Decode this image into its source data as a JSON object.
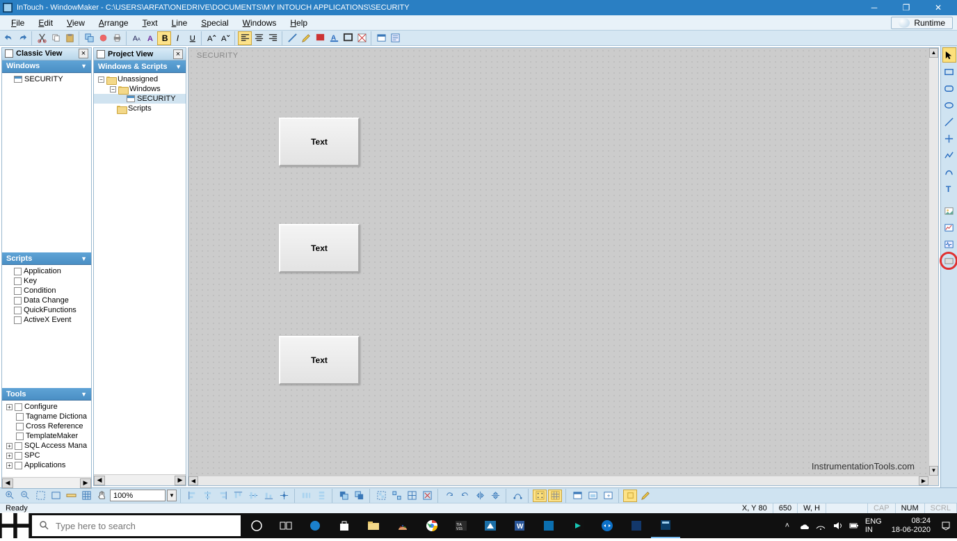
{
  "titlebar": {
    "title": "InTouch - WindowMaker - C:\\USERS\\ARFAT\\ONEDRIVE\\DOCUMENTS\\MY INTOUCH APPLICATIONS\\SECURITY"
  },
  "menus": {
    "file": "File",
    "edit": "Edit",
    "view": "View",
    "arrange": "Arrange",
    "text": "Text",
    "line": "Line",
    "special": "Special",
    "windows": "Windows",
    "help": "Help",
    "runtime": "Runtime"
  },
  "classic": {
    "panel_title": "Classic View",
    "windows_hdr": "Windows",
    "windows_items": [
      "SECURITY"
    ],
    "scripts_hdr": "Scripts",
    "scripts_items": [
      "Application",
      "Key",
      "Condition",
      "Data Change",
      "QuickFunctions",
      "ActiveX Event"
    ],
    "tools_hdr": "Tools",
    "tools_items": [
      "Configure",
      "Tagname Dictiona",
      "Cross Reference",
      "TemplateMaker",
      "SQL Access Mana",
      "SPC",
      "Applications"
    ]
  },
  "project": {
    "panel_title": "Project View",
    "hdr": "Windows & Scripts",
    "root": "Unassigned",
    "windows_node": "Windows",
    "window_item": "SECURITY",
    "scripts_node": "Scripts"
  },
  "canvas": {
    "title": "SECURITY",
    "btn1": "Text",
    "btn2": "Text",
    "btn3": "Text",
    "watermark": "InstrumentationTools.com"
  },
  "zoom": "100%",
  "status": {
    "ready": "Ready",
    "xy_label": "X, Y",
    "xy": "80",
    "x2": "650",
    "wh_label": "W, H",
    "cap": "CAP",
    "num": "NUM",
    "scrl": "SCRL"
  },
  "taskbar": {
    "search_placeholder": "Type here to search",
    "lang1": "ENG",
    "lang2": "IN",
    "time": "08:24",
    "date": "18-06-2020"
  }
}
